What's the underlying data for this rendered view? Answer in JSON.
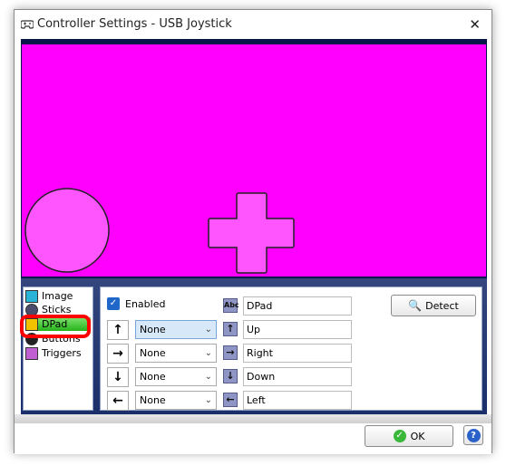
{
  "window": {
    "title": "Controller Settings - USB Joystick"
  },
  "colors": {
    "preview_bg": "#ff00ff",
    "shape_fill": "#ff55ff",
    "active_item": "#26b21c",
    "highlight": "#ff0000"
  },
  "sidebar": {
    "items": [
      {
        "label": "Image",
        "icon": "image-icon"
      },
      {
        "label": "Sticks",
        "icon": "sticks-icon"
      },
      {
        "label": "DPad",
        "icon": "dpad-icon",
        "active": true
      },
      {
        "label": "Buttons",
        "icon": "buttons-icon"
      },
      {
        "label": "Triggers",
        "icon": "triggers-icon"
      }
    ]
  },
  "dpad": {
    "enabled_label": "Enabled",
    "enabled": true,
    "name_value": "DPad",
    "rows": [
      {
        "dir": "up",
        "arrow": "↑",
        "mapping": "None",
        "label": "Up"
      },
      {
        "dir": "right",
        "arrow": "→",
        "mapping": "None",
        "label": "Right"
      },
      {
        "dir": "down",
        "arrow": "↓",
        "mapping": "None",
        "label": "Down"
      },
      {
        "dir": "left",
        "arrow": "←",
        "mapping": "None",
        "label": "Left"
      }
    ]
  },
  "buttons": {
    "detect": "Detect",
    "ok": "OK",
    "help": "?"
  }
}
